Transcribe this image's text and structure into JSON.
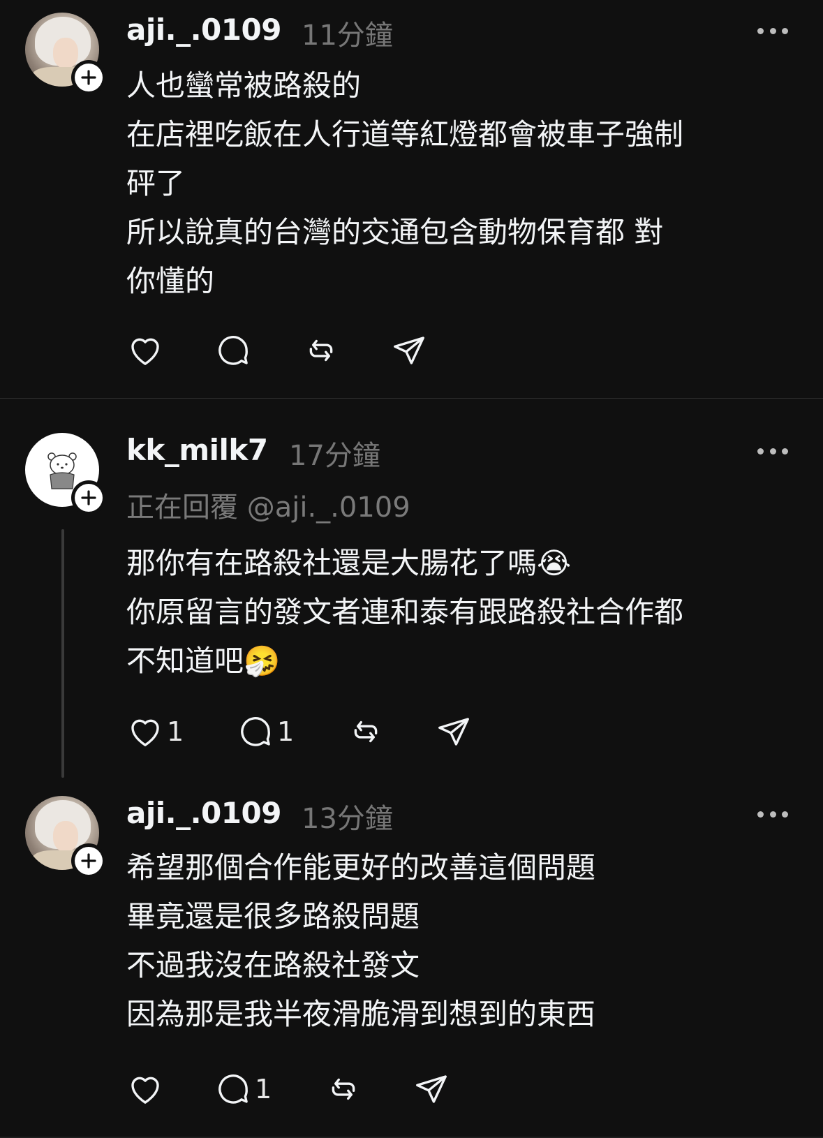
{
  "posts": [
    {
      "username": "aji._.0109",
      "time": "11分鐘",
      "lines": [
        "人也蠻常被路殺的",
        "在店裡吃飯在人行道等紅燈都會被車子強制",
        "砰了",
        "所以說真的台灣的交通包含動物保育都 對",
        "你懂的"
      ],
      "like_count": "",
      "reply_count": ""
    },
    {
      "username": "kk_milk7",
      "time": "17分鐘",
      "replying_to": "正在回覆 @aji._.0109",
      "lines": [
        "那你有在路殺社還是大腸花了嗎😭",
        "你原留言的發文者連和泰有跟路殺社合作都",
        "不知道吧🤧"
      ],
      "like_count": "1",
      "reply_count": "1"
    },
    {
      "username": "aji._.0109",
      "time": "13分鐘",
      "lines": [
        "希望那個合作能更好的改善這個問題",
        "畢竟還是很多路殺問題",
        "不過我沒在路殺社發文",
        "因為那是我半夜滑脆滑到想到的東西"
      ],
      "like_count": "",
      "reply_count": "1"
    }
  ],
  "icons": [
    "heart-icon",
    "reply-icon",
    "repost-icon",
    "share-icon",
    "more-icon",
    "follow-plus-icon"
  ]
}
